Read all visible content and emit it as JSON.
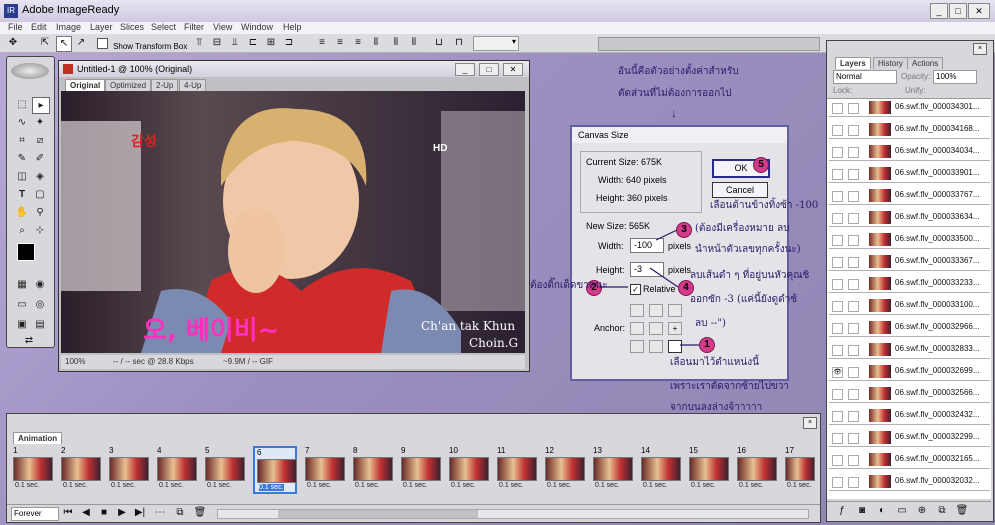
{
  "window": {
    "title": "Adobe ImageReady"
  },
  "menu": [
    "File",
    "Edit",
    "Image",
    "Layer",
    "Slices",
    "Select",
    "Filter",
    "View",
    "Window",
    "Help"
  ],
  "options": {
    "show_transform_box": "Show Transform Box"
  },
  "document": {
    "title": "Untitled-1 @ 100% (Original)",
    "tabs": [
      "Original",
      "Optimized",
      "2-Up",
      "4-Up"
    ],
    "active_tab": "Original",
    "overlay_texts": [
      "HD",
      "Ch'an tak Khun",
      "Choin.G"
    ],
    "status": {
      "zoom": "100%",
      "speed": "-- / -- sec @ 28.8 Kbps",
      "size": "~9.9M / -- GIF"
    }
  },
  "dialog": {
    "title": "Canvas Size",
    "current_size_label": "Current Size: 675K",
    "cur_width": "Width:  640 pixels",
    "cur_height": "Height:  360 pixels",
    "new_size_label": "New Size: 565K",
    "width_label": "Width:",
    "width_value": "-100",
    "width_unit": "pixels",
    "height_label": "Height:",
    "height_value": "-3",
    "height_unit": "pixels",
    "relative_label": "Relative",
    "anchor_label": "Anchor:",
    "ok": "OK",
    "cancel": "Cancel"
  },
  "annotations": {
    "top_line1": "อันนี้คือตัวอย่างตั้งค่าสำหรับ",
    "top_line2": "ตัดส่วนที่ไม่ต้องการออกไป",
    "right_1": "เลือนด้านข้างทิ้งซ้า -100",
    "right_2": "(ต้องมีเครื่องหมาย ลบ",
    "right_3": "นำหน้าตัวเลขทุกครั้งนะ)",
    "right_4": "ลบเส้นดำ ๆ ที่อยู่บนหัวคุณชิ",
    "right_5": "ออกซัก -3 (แค่นี้ยังดูดำซ้",
    "right_6": "ลบ --\")",
    "left_relative": "ต้องติ๊กเด็ดขาดนะ",
    "bottom_1": "เลือนมาไว้ตำแหน่งนี้",
    "bottom_2": "เพราะเราตัดจากซ้ายไปขวา",
    "bottom_3": "จากบนลงล่างจ้าาาาา",
    "badges": [
      "1",
      "2",
      "3",
      "4",
      "5"
    ]
  },
  "layers_panel": {
    "tabs": [
      "Layers",
      "History",
      "Actions"
    ],
    "blend_mode": "Normal",
    "opacity_label": "Opacity:",
    "opacity_value": "100%",
    "lock_label": "Lock:",
    "unify_label": "Unify:",
    "layers": [
      "06.swf.flv_000034301...",
      "06.swf.flv_000034168...",
      "06.swf.flv_000034034...",
      "06.swf.flv_000033901...",
      "06.swf.flv_000033767...",
      "06.swf.flv_000033634...",
      "06.swf.flv_000033500...",
      "06.swf.flv_000033367...",
      "06.swf.flv_000033233...",
      "06.swf.flv_000033100...",
      "06.swf.flv_000032966...",
      "06.swf.flv_000032833...",
      "06.swf.flv_000032699...",
      "06.swf.flv_000032566...",
      "06.swf.flv_000032432...",
      "06.swf.flv_000032299...",
      "06.swf.flv_000032165...",
      "06.swf.flv_000032032..."
    ]
  },
  "animation": {
    "tab": "Animation",
    "frames": [
      "1",
      "2",
      "3",
      "4",
      "5",
      "6",
      "7",
      "8",
      "9",
      "10",
      "11",
      "12",
      "13",
      "14",
      "15",
      "16",
      "17"
    ],
    "delay": "0.1 sec.",
    "selected_frame": "6",
    "loop": "Forever"
  }
}
